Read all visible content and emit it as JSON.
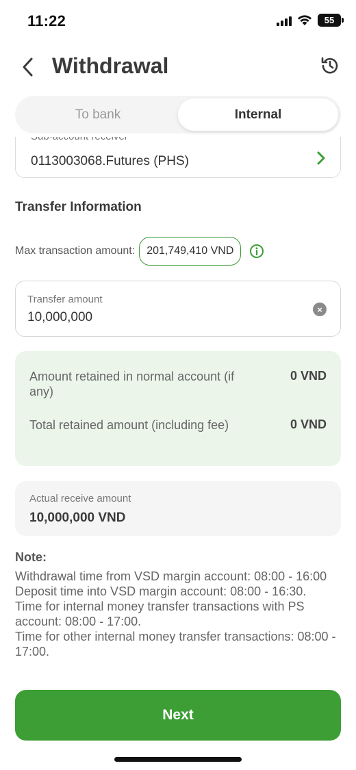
{
  "status_bar": {
    "time": "11:22",
    "battery": "55"
  },
  "header": {
    "title": "Withdrawal"
  },
  "tabs": [
    {
      "label": "To bank",
      "active": false
    },
    {
      "label": "Internal",
      "active": true
    }
  ],
  "sub_account": {
    "label": "Sub-account receiver",
    "value": "0113003068.Futures (PHS)"
  },
  "transfer_info": {
    "section_title": "Transfer Information",
    "max_label": "Max transaction amount:",
    "max_value": "201,749,410 VND",
    "amount_label": "Transfer amount",
    "amount_value": "10,000,000"
  },
  "retained": {
    "rows": [
      {
        "label": "Amount retained in normal account (if any)",
        "value": "0 VND"
      },
      {
        "label": "Total retained amount (including fee)",
        "value": "0 VND"
      }
    ]
  },
  "actual": {
    "label": "Actual receive amount",
    "value": "10,000,000 VND"
  },
  "note": {
    "title": "Note:",
    "lines": [
      "Withdrawal time from VSD margin account: 08:00 - 16:00",
      "Deposit time into VSD margin account: 08:00 - 16:30.",
      "Time for internal money transfer transactions with PS account: 08:00 - 17:00.",
      "Time for other internal money transfer transactions: 08:00 - 17:00."
    ]
  },
  "footer": {
    "next_label": "Next"
  },
  "colors": {
    "accent": "#3d9e35",
    "retained_bg": "#ebf5ea",
    "actual_bg": "#f5f5f5"
  }
}
